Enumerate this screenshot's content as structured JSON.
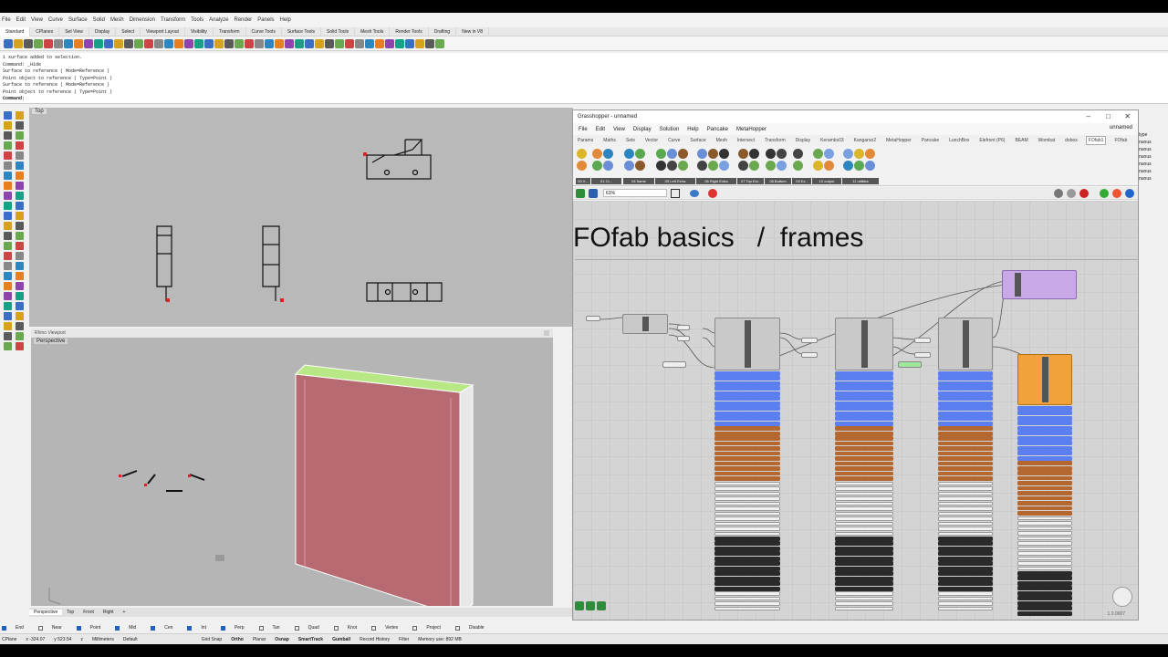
{
  "rhino": {
    "menu": [
      "File",
      "Edit",
      "View",
      "Curve",
      "Surface",
      "Solid",
      "Mesh",
      "Dimension",
      "Transform",
      "Tools",
      "Analyze",
      "Render",
      "Panels",
      "Help"
    ],
    "toolbar_tabs": [
      "Standard",
      "CPlanes",
      "Set View",
      "Display",
      "Select",
      "Viewport Layout",
      "Visibility",
      "Transform",
      "Curve Tools",
      "Surface Tools",
      "Solid Tools",
      "Mesh Tools",
      "Render Tools",
      "Drafting",
      "New in V8"
    ],
    "active_tab": "Standard",
    "command_history": [
      "1 surface added to selection.",
      "Command: _Hide",
      "Surface to reference ( Mode=Reference )",
      "Point object to reference ( Type=Point )",
      "Surface to reference ( Mode=Reference )",
      "Point object to reference ( Type=Point )"
    ],
    "command_prompt": "Command:",
    "viewport_top_label": "Top",
    "viewport_persp_window_title": "Rhino Viewport",
    "viewport_persp_label": "Perspective",
    "viewport_tabs": [
      "Perspective",
      "Top",
      "Front",
      "Right",
      "+"
    ],
    "osnaps": [
      {
        "label": "End",
        "checked": true
      },
      {
        "label": "Near",
        "checked": false
      },
      {
        "label": "Point",
        "checked": true
      },
      {
        "label": "Mid",
        "checked": true
      },
      {
        "label": "Cen",
        "checked": true
      },
      {
        "label": "Int",
        "checked": true
      },
      {
        "label": "Perp",
        "checked": true
      },
      {
        "label": "Tan",
        "checked": false
      },
      {
        "label": "Quad",
        "checked": false
      },
      {
        "label": "Knot",
        "checked": false
      },
      {
        "label": "Vertex",
        "checked": false
      },
      {
        "label": "Project",
        "checked": false
      },
      {
        "label": "Disable",
        "checked": false
      }
    ],
    "status": {
      "cplane": "CPlane",
      "x": "x -324.07",
      "y": "y 523.54",
      "z": "z",
      "units": "Millimeters",
      "layer": "Default",
      "grid_snap": "Grid Snap",
      "ortho": "Ortho",
      "planar": "Planar",
      "osnap": "Osnap",
      "smarttrack": "SmartTrack",
      "gumball": "Gumball",
      "record_history": "Record History",
      "filter": "Filter",
      "memory": "Memory use: 892 MB"
    }
  },
  "grasshopper": {
    "window_title": "Grasshopper - unnamed",
    "doc_name": "unnamed",
    "menu": [
      "File",
      "Edit",
      "View",
      "Display",
      "Solution",
      "Help",
      "Pancake",
      "MetaHopper"
    ],
    "tabs": [
      "Params",
      "Maths",
      "Sets",
      "Vector",
      "Curve",
      "Surface",
      "Mesh",
      "Intersect",
      "Transform",
      "Display",
      "Kerambs03",
      "Kangaroo2",
      "MetaHopper",
      "Pancake",
      "LunchBox",
      "Elefront (P6)",
      "BEAM",
      "Wombat",
      "dobox",
      "FOfab1",
      "FOfab"
    ],
    "active_tab": "FOfab1",
    "ribbon_groups": [
      "00 X...",
      "01 Ct...",
      "04 frame",
      "05 Left Extra",
      "06 Right Extra",
      "07 Top Ext..",
      "08 Bottom",
      "09 Ex..",
      "10 output",
      "11 utilities"
    ],
    "zoom": "61%",
    "canvas_heading": "FOfab basics   /  frames",
    "version": "1.0.0007"
  },
  "right_panel": {
    "items": [
      "type",
      "nuous",
      "nuous",
      "nuous",
      "nuous",
      "nuous",
      "nuous"
    ]
  },
  "colors": {
    "gh_blue": "#5b7ff0",
    "gh_brown": "#b4682f",
    "gh_orange": "#f2a23a",
    "gh_purple": "#c9a8e8",
    "surface_pink": "#b86a72",
    "surface_green": "#b8e886"
  }
}
